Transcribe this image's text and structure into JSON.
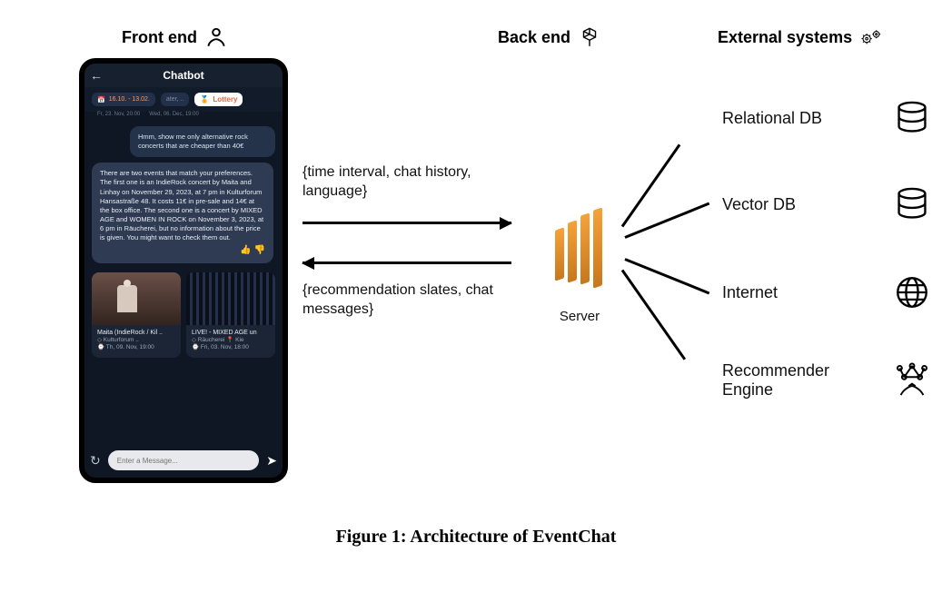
{
  "sections": {
    "front_end": "Front end",
    "back_end": "Back end",
    "external": "External systems"
  },
  "phone": {
    "title": "Chatbot",
    "date_chip": "16.10. - 13.02.",
    "mid_chip": "ater, ..",
    "lottery_chip": "Lottery",
    "time_row_left": "Fr, 23. Nov, 20:00",
    "time_row_right": "Wed, 06. Dec, 19:00",
    "user_msg": "Hmm, show me only alternative rock concerts that are cheaper than 40€",
    "bot_msg": "There are two events that match your preferences. The first one is an IndieRock concert by Maita and Linhay on November 29, 2023, at 7 pm in Kulturforum Hansastraße 48. It costs 11€ in pre-sale and 14€ at the box office. The second one is a concert by MIXED AGE and WOMEN IN ROCK on November 3, 2023, at 6 pm in Räucherei, but no information about the price is given. You might want to check them out.",
    "card1": {
      "title": "Maita (IndieRock / Kil ..",
      "venue": "◇ Kulturforum ..",
      "time": "⌚ Th, 09. Nov, 19:00"
    },
    "card2": {
      "title": "LIVE! - MIXED AGE un",
      "venue": "◇ Räucherei  📍 Kie",
      "time": "⌚ Fri, 03. Nov, 18:00"
    },
    "composer_placeholder": "Enter a Message..."
  },
  "flow": {
    "to_server": "{time interval, chat history, language}",
    "from_server": "{recommendation slates, chat messages}",
    "server_label": "Server"
  },
  "external_items": {
    "relational": "Relational DB",
    "vector": "Vector DB",
    "internet": "Internet",
    "recommender": "Recommender Engine"
  },
  "caption": "Figure 1: Architecture of EventChat"
}
